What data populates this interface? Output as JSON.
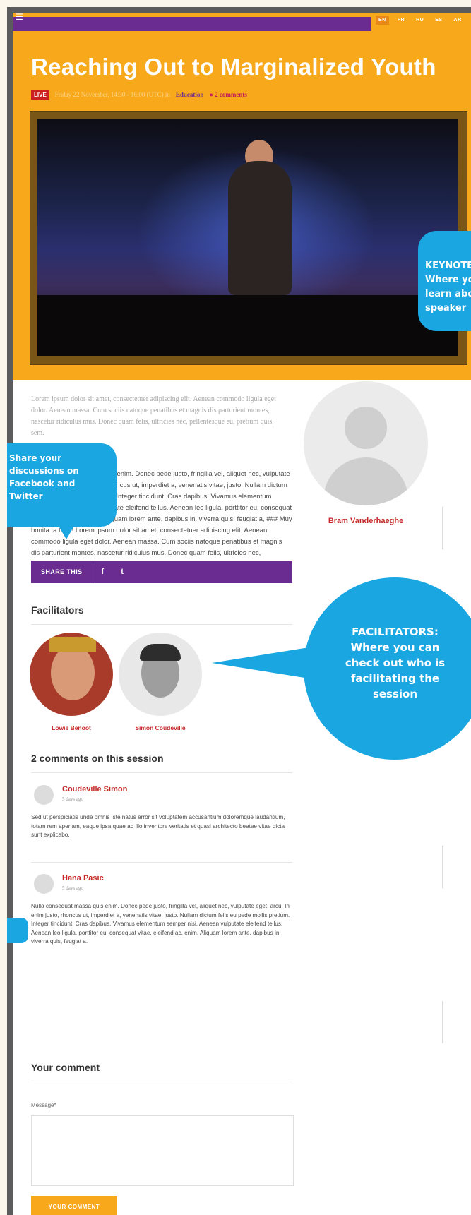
{
  "header": {
    "menu_icon": "menu-icon",
    "languages": [
      "EN",
      "FR",
      "RU",
      "ES",
      "AR"
    ],
    "active_language": "EN"
  },
  "session": {
    "title": "Reaching Out to Marginalized Youth",
    "live_badge": "LIVE",
    "date_time": "Friday 22 November, 14:30 - 16:00 (UTC) in",
    "category": "Education",
    "comments_link": "2 comments"
  },
  "callouts": {
    "keynote": "KEYNOTE: Where you learn about the speaker",
    "share": "Share your discussions on Facebook and Twitter",
    "facilitators": "FACILITATORS: Where you can check out who is facilitating the session"
  },
  "body": {
    "lead": "Lorem ipsum dolor sit amet, consectetuer adipiscing elit. Aenean commodo ligula eget dolor. Aenean massa. Cum sociis natoque penatibus et magnis dis parturient montes, nascetur ridiculus mus. Donec quam felis, ultricies nec, pellentesque eu, pretium quis, sem.",
    "paragraph": "Nulla consequat massa quis enim. Donec pede justo, fringilla vel, aliquet nec, vulputate eget, arcu. In enim justo, rhoncus ut, imperdiet a, venenatis vitae, justo. Nullam dictum felis eu pede mollis pretium. Integer tincidunt. Cras dapibus. Vivamus elementum semper nisi. asdfqsdf vulputate eleifend tellus. Aenean leo ligula, porttitor eu, consequat vitae, eleifend ac, enim. Aliquam lorem ante, dapibus in, viverra quis, feugiat a, ### Muy bonita ta ta ta! Lorem ipsum dolor sit amet, consectetuer adipiscing elit. Aenean commodo ligula eget dolor. Aenean massa. Cum sociis natoque penatibus et magnis dis parturient montes, nascetur ridiculus mus. Donec quam felis, ultricies nec, pellentesque eu, pretium quis, sem."
  },
  "speaker": {
    "name": "Bram Vanderhaeghe"
  },
  "share": {
    "label": "SHARE THIS",
    "facebook": "f",
    "twitter": "t"
  },
  "facilitators": {
    "heading": "Facilitators",
    "people": [
      {
        "name": "Lowie Benoot"
      },
      {
        "name": "Simon Coudeville"
      }
    ]
  },
  "comments": {
    "heading": "2 comments on this session",
    "items": [
      {
        "author": "Coudeville Simon",
        "time": "5 days ago",
        "text": "Sed ut perspiciatis unde omnis iste natus error sit voluptatem accusantium doloremque laudantium, totam rem aperiam, eaque ipsa quae ab illo inventore veritatis et quasi architecto beatae vitae dicta sunt explicabo."
      },
      {
        "author": "Hana Pasic",
        "time": "5 days ago",
        "text": "Nulla consequat massa quis enim. Donec pede justo, fringilla vel, aliquet nec, vulputate eget, arcu. In enim justo, rhoncus ut, imperdiet a, venenatis vitae, justo. Nullam dictum felis eu pede mollis pretium. Integer tincidunt. Cras dapibus. Vivamus elementum semper nisi. Aenean vulputate eleifend tellus. Aenean leo ligula, porttitor eu, consequat vitae, eleifend ac, enim. Aliquam lorem ante, dapibus in, viverra quis, feugiat a."
      }
    ]
  },
  "form": {
    "heading": "Your comment",
    "message_label": "Message*",
    "submit_label": "YOUR COMMENT"
  },
  "colors": {
    "orange": "#f7a81b",
    "purple": "#6a2c91",
    "red": "#c62828",
    "callout_blue": "#1aa6e1"
  }
}
